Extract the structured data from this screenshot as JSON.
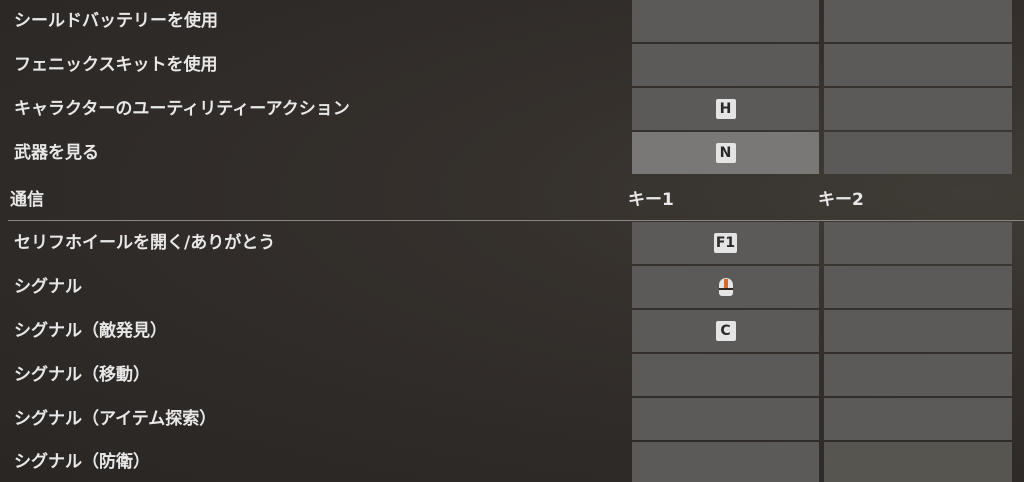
{
  "top_rows": [
    {
      "label": "シールドバッテリーを使用",
      "key1": "",
      "key2": ""
    },
    {
      "label": "フェニックスキットを使用",
      "key1": "",
      "key2": ""
    },
    {
      "label": "キャラクターのユーティリティーアクション",
      "key1": "H",
      "key2": ""
    },
    {
      "label": "武器を見る",
      "key1": "N",
      "key2": ""
    }
  ],
  "section": {
    "title": "通信",
    "col1": "キー1",
    "col2": "キー2"
  },
  "comm_rows": [
    {
      "label": "セリフホイールを開く/ありがとう",
      "key1": "F1",
      "key2": ""
    },
    {
      "label": "シグナル",
      "key1_icon": "mouse-middle-button-icon",
      "key2": ""
    },
    {
      "label": "シグナル（敵発見）",
      "key1": "C",
      "key2": ""
    },
    {
      "label": "シグナル（移動）",
      "key1": "",
      "key2": ""
    },
    {
      "label": "シグナル（アイテム探索）",
      "key1": "",
      "key2": ""
    },
    {
      "label": "シグナル（防衛）",
      "key1": "",
      "key2": ""
    }
  ],
  "colors": {
    "slot": "#5c5a59",
    "slot_active": "#7a7877",
    "key_cap": "#e4e4e4",
    "mouse_accent": "#d26a2e"
  }
}
